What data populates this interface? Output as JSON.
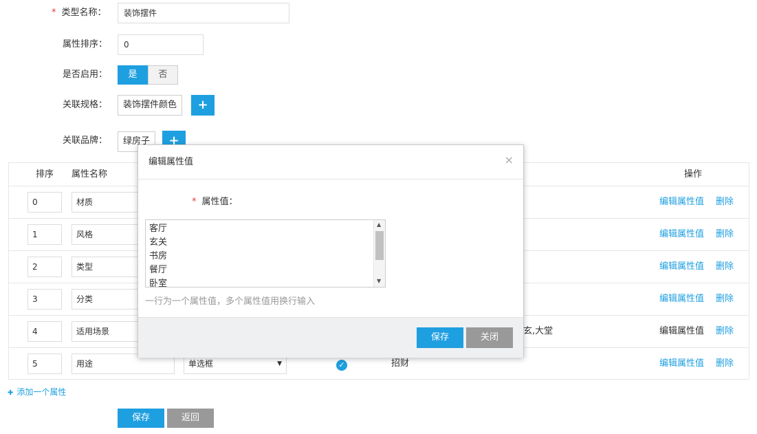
{
  "form": {
    "type_name_label": "类型名称：",
    "required_mark": "*",
    "type_name_value": "装饰摆件",
    "sort_label": "属性排序：",
    "sort_value": "0",
    "enabled_label": "是否启用：",
    "enabled_yes": "是",
    "enabled_no": "否",
    "spec_label": "关联规格：",
    "spec_tag": "装饰摆件颜色",
    "brand_label": "关联品牌：",
    "brand_tag": "绿房子",
    "plus": "+"
  },
  "table": {
    "headers": {
      "sort": "排序",
      "name": "属性名称",
      "action": "操作"
    },
    "rows": [
      {
        "sort": "0",
        "name": "材质",
        "edit": "编辑属性值",
        "delete": "删除"
      },
      {
        "sort": "1",
        "name": "风格",
        "edit": "编辑属性值",
        "delete": "删除"
      },
      {
        "sort": "2",
        "name": "类型",
        "edit": "编辑属性值",
        "delete": "删除"
      },
      {
        "sort": "3",
        "name": "分类",
        "edit": "编辑属性值",
        "delete": "删除"
      },
      {
        "sort": "4",
        "name": "适用场景",
        "values_tail": "玄,大堂",
        "edit": "编辑属性值",
        "delete": "删除"
      },
      {
        "sort": "5",
        "name": "用途",
        "type": "单选框",
        "values": "招财",
        "edit": "编辑属性值",
        "delete": "删除"
      }
    ]
  },
  "add_attr": {
    "icon": "✚",
    "label": "添加一个属性"
  },
  "bottom": {
    "save": "保存",
    "back": "返回"
  },
  "modal": {
    "title": "编辑属性值",
    "close": "×",
    "field_label": "属性值：",
    "required_mark": "*",
    "values": [
      "客厅",
      "玄关",
      "书房",
      "餐厅",
      "卧室"
    ],
    "hint": "一行为一个属性值，多个属性值用换行输入",
    "save": "保存",
    "close_btn": "关闭"
  },
  "colors": {
    "primary": "#1e9fe0",
    "gray_button": "#999999",
    "required": "#e4393c"
  }
}
